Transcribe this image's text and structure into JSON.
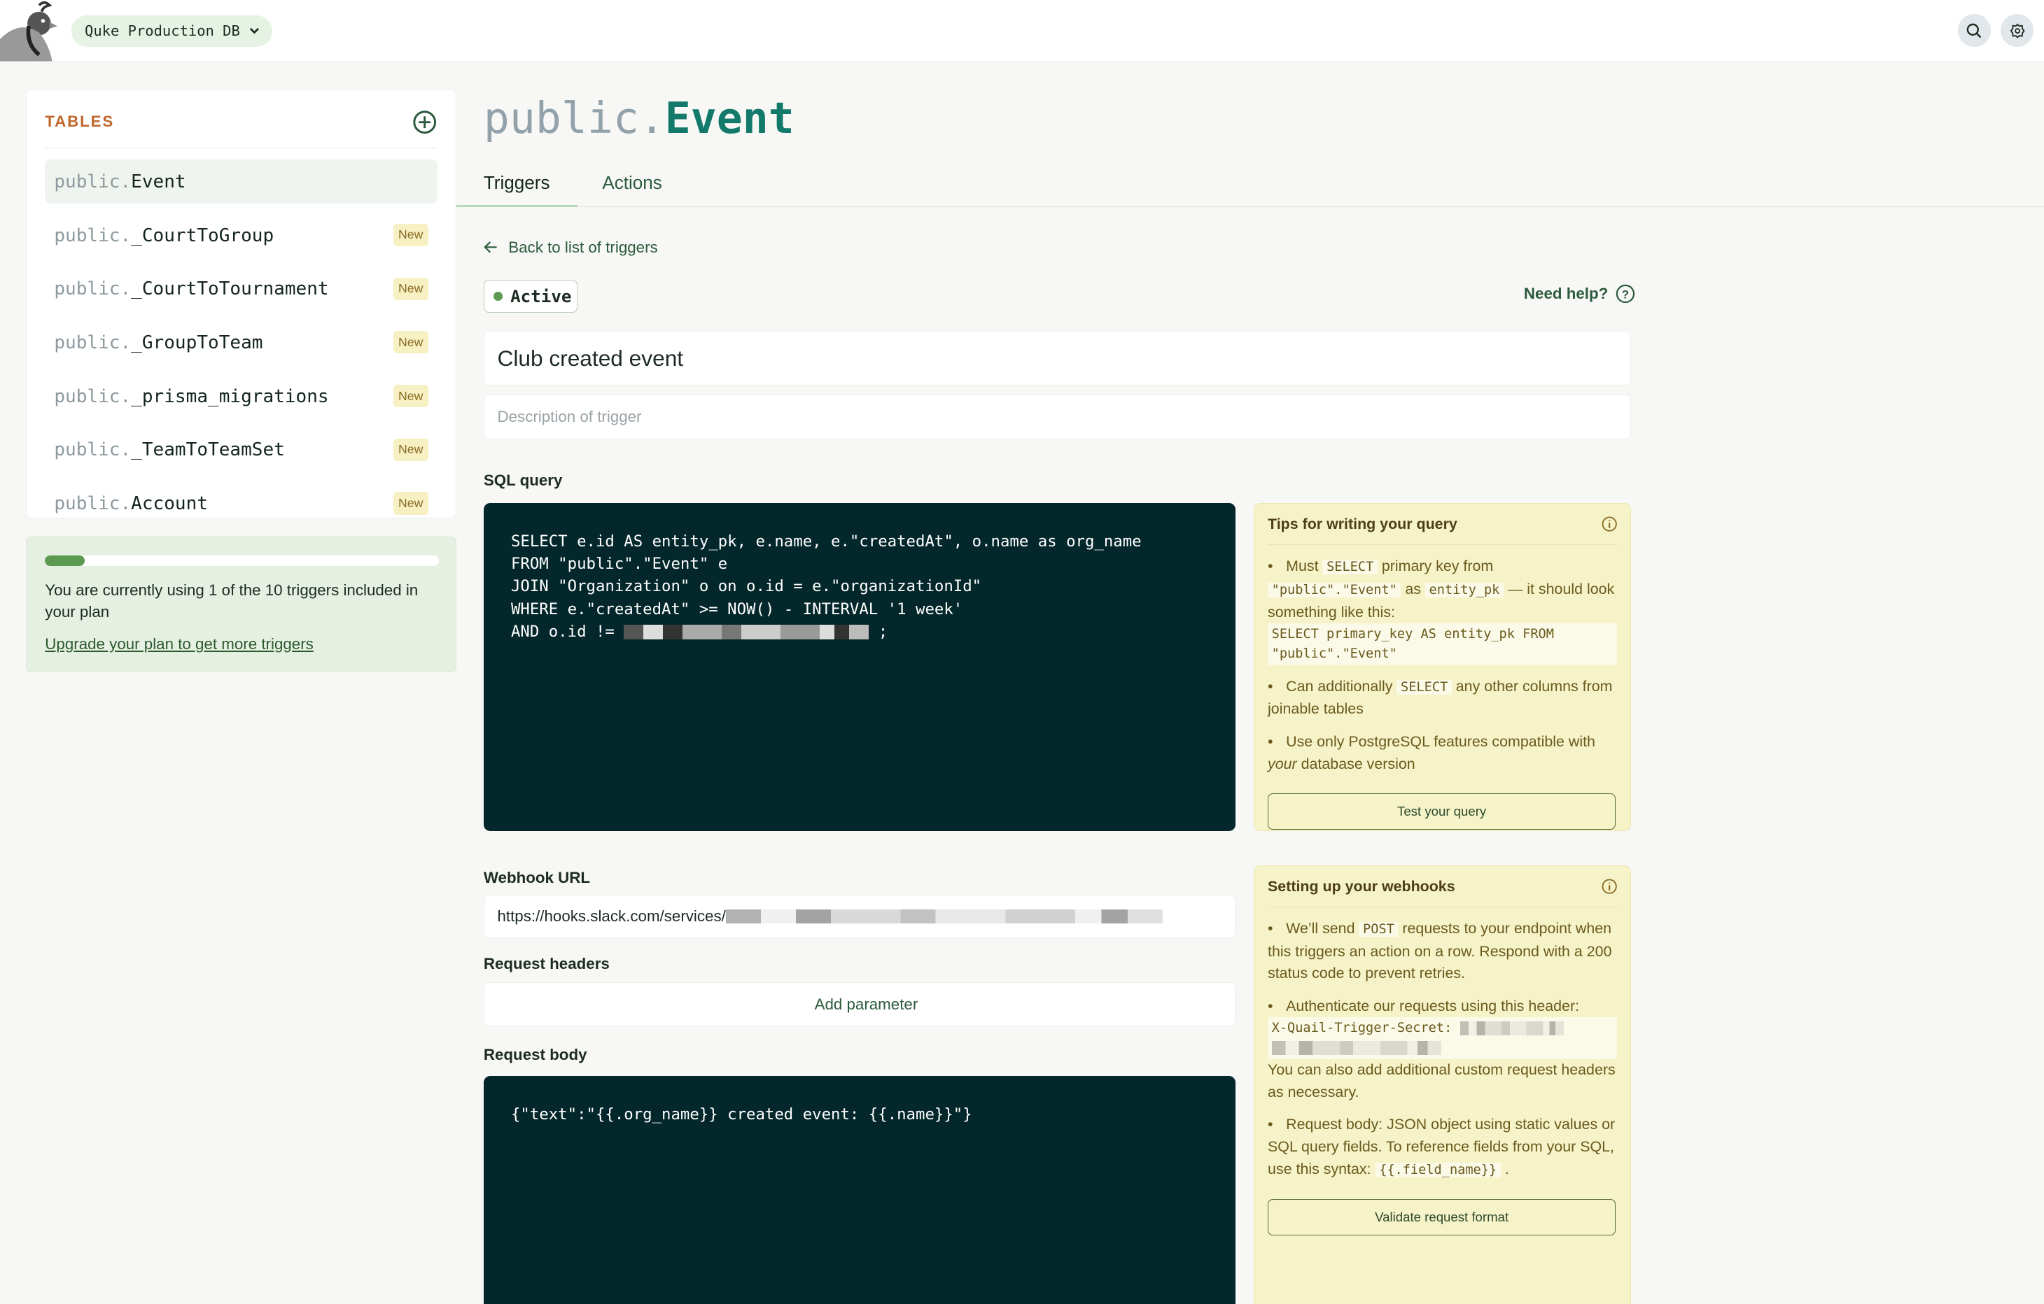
{
  "header": {
    "db_name": "Quke Production DB",
    "icons": [
      "quail-logo",
      "chevron-down-icon",
      "search-icon",
      "gear-icon"
    ]
  },
  "sidebar": {
    "title": "TABLES",
    "items": [
      {
        "schema": "public.",
        "name": "Event",
        "badge": ""
      },
      {
        "schema": "public.",
        "name": "_CourtToGroup",
        "badge": "New"
      },
      {
        "schema": "public.",
        "name": "_CourtToTournament",
        "badge": "New"
      },
      {
        "schema": "public.",
        "name": "_GroupToTeam",
        "badge": "New"
      },
      {
        "schema": "public.",
        "name": "_prisma_migrations",
        "badge": "New"
      },
      {
        "schema": "public.",
        "name": "_TeamToTeamSet",
        "badge": "New"
      },
      {
        "schema": "public.",
        "name": "Account",
        "badge": "New"
      }
    ]
  },
  "usage": {
    "text": "You are currently using 1 of the 10 triggers included in your plan",
    "progress": 0.1,
    "upgrade_link": "Upgrade your plan to get more triggers"
  },
  "main": {
    "title_schema": "public.",
    "title_table": "Event",
    "tabs": [
      {
        "label": "Triggers"
      },
      {
        "label": "Actions"
      }
    ],
    "back_link": "Back to list of triggers",
    "status": "Active",
    "help": "Need help?",
    "trigger_name": "Club created event",
    "description_placeholder": "Description of trigger",
    "sql_label": "SQL query",
    "sql_lines": [
      "SELECT e.id AS entity_pk, e.name, e.\"createdAt\", o.name as org_name",
      "FROM \"public\".\"Event\" e",
      "JOIN \"Organization\" o on o.id = e.\"organizationId\"",
      "WHERE e.\"createdAt\" >= NOW() - INTERVAL '1 week'",
      "AND o.id != "
    ],
    "sql_end": ";",
    "webhook_label": "Webhook URL",
    "webhook_url": "https://hooks.slack.com/services/",
    "headers_label": "Request headers",
    "add_parameter": "Add parameter",
    "body_label": "Request body",
    "body": "{\"text\":\"{{.org_name}} created event: {{.name}}\"}"
  },
  "tips_query": {
    "title": "Tips for writing your query",
    "t1a": "Must",
    "t1b": "SELECT",
    "t1c": "primary key from",
    "t1d": "\"public\".\"Event\"",
    "t1e": "as",
    "t1f": "entity_pk",
    "t1g": "— it should look something like this:",
    "t1code": "SELECT primary_key AS entity_pk FROM \"public\".\"Event\"",
    "t2a": "Can additionally",
    "t2b": "SELECT",
    "t2c": "any other columns from joinable tables",
    "t3a": "Use only PostgreSQL features compatible with",
    "t3b": "your",
    "t3c": "database version",
    "button": "Test your query"
  },
  "tips_webhook": {
    "title": "Setting up your webhooks",
    "w1a": "We’ll send",
    "w1b": "POST",
    "w1c": "requests to your endpoint when this triggers an action on a row. Respond with a 200 status code to prevent retries.",
    "w2a": "Authenticate our requests using this header:",
    "w2code": "X-Quail-Trigger-Secret:",
    "w2b": "You can also add additional custom request headers as necessary.",
    "w3a": "Request body: JSON object using static values or SQL query fields. To reference fields from your SQL, use this syntax:",
    "w3b": "{{.field_name}}",
    "w3c": ".",
    "button": "Validate request format"
  },
  "colors": {
    "accent": "#137a6b",
    "code_bg": "#03272a",
    "tips_bg": "#f6f3c9",
    "tables_title": "#c0662b",
    "progress": "#5c9a51"
  }
}
